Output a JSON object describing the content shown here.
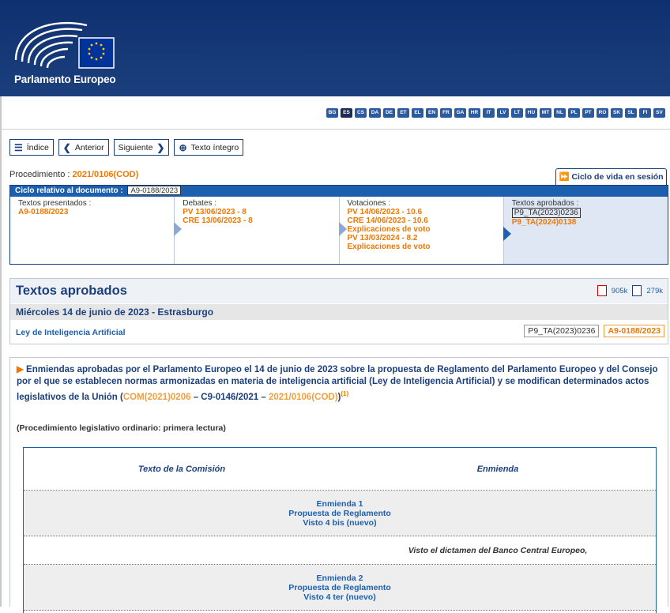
{
  "header": {
    "logo_text": "Parlamento Europeo"
  },
  "languages": [
    "BG",
    "ES",
    "CS",
    "DA",
    "DE",
    "ET",
    "EL",
    "EN",
    "FR",
    "GA",
    "HR",
    "IT",
    "LV",
    "LT",
    "HU",
    "MT",
    "NL",
    "PL",
    "PT",
    "RO",
    "SK",
    "SL",
    "FI",
    "SV"
  ],
  "active_language": "ES",
  "nav": {
    "index": "Índice",
    "previous": "Anterior",
    "next": "Siguiente",
    "full_text": "Texto íntegro"
  },
  "procedure": {
    "label": "Procedimiento : ",
    "ref": "2021/0106(COD)"
  },
  "life_cycle_button": "Ciclo de vida en sesión",
  "cycle": {
    "head_label": "Ciclo relativo al documento : ",
    "head_tag": "A9-0188/2023",
    "cols": [
      {
        "title": "Textos presentados :",
        "lines": [
          "A9-0188/2023"
        ]
      },
      {
        "title": "Debates :",
        "lines": [
          "PV 13/06/2023 - 8",
          "CRE 13/06/2023 - 8"
        ]
      },
      {
        "title": "Votaciones :",
        "lines": [
          "PV 14/06/2023 - 10.6",
          "CRE 14/06/2023 - 10.6",
          "Explicaciones de voto",
          "PV 13/03/2024 - 8.2",
          "Explicaciones de voto"
        ]
      },
      {
        "title": "Textos aprobados :",
        "box": "P9_TA(2023)0236",
        "lines": [
          "P9_TA(2024)0138"
        ]
      }
    ]
  },
  "section": {
    "title": "Textos aprobados",
    "pdf_size": "905k",
    "word_size": "279k",
    "date": "Miércoles 14 de junio de 2023 - Estrasburgo",
    "law": "Ley de Inteligencia Artificial",
    "ref1": "P9_TA(2023)0236",
    "ref2": "A9-0188/2023"
  },
  "intro": {
    "text": "Enmiendas aprobadas por el Parlamento Europeo el 14 de junio de 2023 sobre la propuesta de Reglamento del Parlamento Europeo y del Consejo por el que se establecen normas armonizadas en materia de inteligencia artificial (Ley de Inteligencia Artificial) y se modifican determinados actos legislativos de la Unión (",
    "com": "COM(2021)0206",
    "mid": " – C9-0146/2021 – ",
    "cod": "2021/0106(COD)",
    "close": ")",
    "note": "(1)"
  },
  "ordinary": "(Procedimiento legislativo ordinario: primera lectura)",
  "table": {
    "col_commission": "Texto de la Comisión",
    "col_amendment": "Enmienda",
    "amendments": [
      {
        "lines": [
          "Enmienda 1",
          "Propuesta de Reglamento",
          "Visto 4 bis (nuevo)"
        ],
        "left": "",
        "right": "Visto el dictamen del Banco Central Europeo,"
      },
      {
        "lines": [
          "Enmienda 2",
          "Propuesta de Reglamento",
          "Visto 4 ter (nuevo)"
        ]
      }
    ]
  }
}
